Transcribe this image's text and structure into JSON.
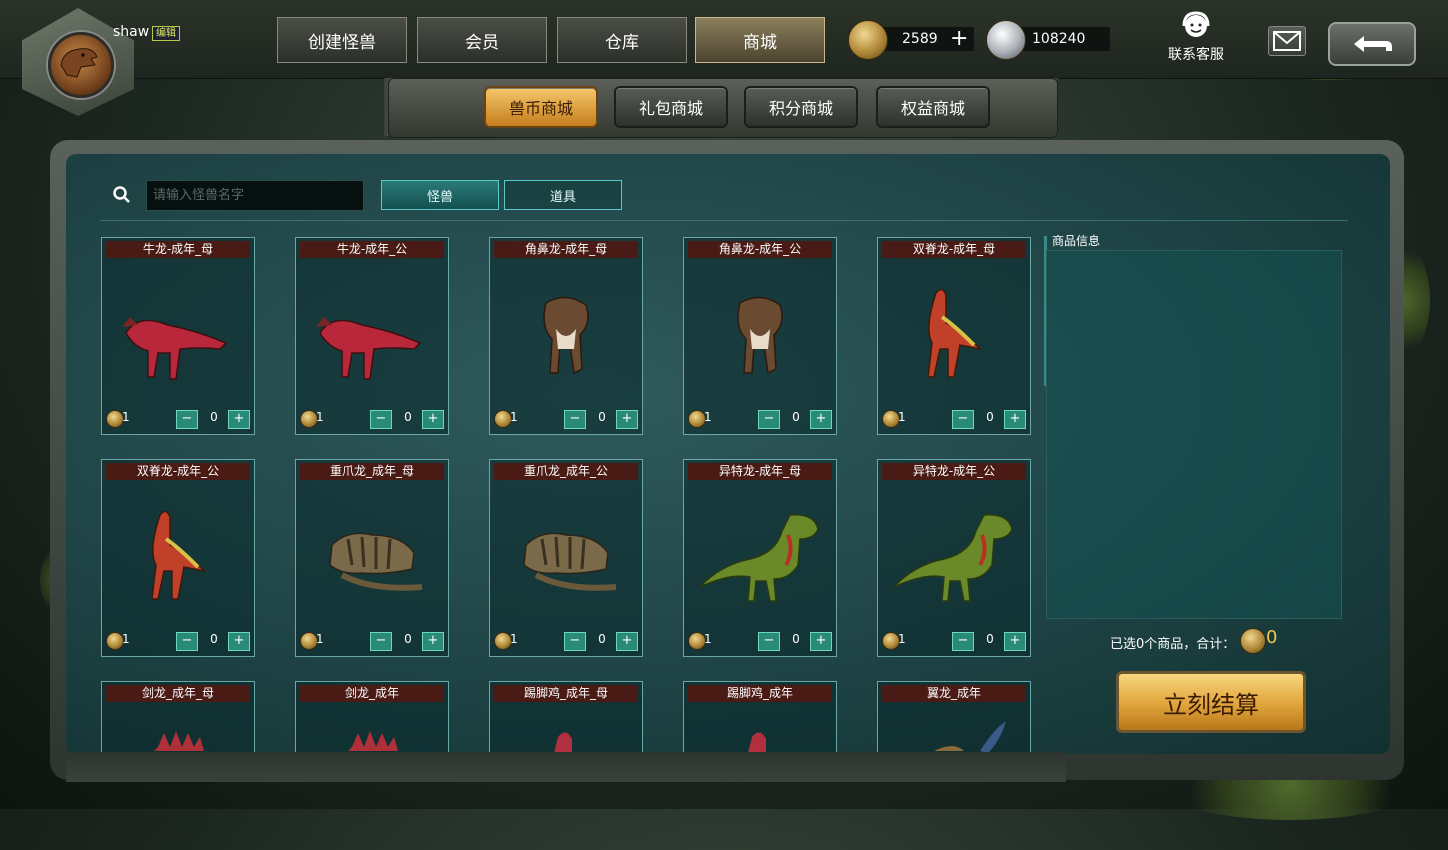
{
  "user": {
    "name": "shaw",
    "edit_label": "编辑"
  },
  "nav": [
    {
      "label": "创建怪兽",
      "active": false
    },
    {
      "label": "会员",
      "active": false
    },
    {
      "label": "仓库",
      "active": false
    },
    {
      "label": "商城",
      "active": true
    }
  ],
  "currency": {
    "gold": "2589",
    "silver": "108240"
  },
  "service_label": "联系客服",
  "shop_tabs": [
    {
      "label": "兽币商城",
      "active": true
    },
    {
      "label": "礼包商城",
      "active": false
    },
    {
      "label": "积分商城",
      "active": false
    },
    {
      "label": "权益商城",
      "active": false
    }
  ],
  "search": {
    "placeholder": "请输入怪兽名字"
  },
  "filter_tabs": [
    {
      "label": "怪兽",
      "active": true
    },
    {
      "label": "道具",
      "active": false
    }
  ],
  "products": [
    {
      "name": "牛龙-成年_母",
      "price": "1",
      "qty": "0",
      "icon": "carnotaurus"
    },
    {
      "name": "牛龙-成年_公",
      "price": "1",
      "qty": "0",
      "icon": "carnotaurus"
    },
    {
      "name": "角鼻龙-成年_母",
      "price": "1",
      "qty": "0",
      "icon": "ceratosaurus"
    },
    {
      "name": "角鼻龙-成年_公",
      "price": "1",
      "qty": "0",
      "icon": "ceratosaurus"
    },
    {
      "name": "双脊龙-成年_母",
      "price": "1",
      "qty": "0",
      "icon": "dilophosaurus"
    },
    {
      "name": "双脊龙-成年_公",
      "price": "1",
      "qty": "0",
      "icon": "dilophosaurus"
    },
    {
      "name": "重爪龙_成年_母",
      "price": "1",
      "qty": "0",
      "icon": "baryonyx"
    },
    {
      "name": "重爪龙_成年_公",
      "price": "1",
      "qty": "0",
      "icon": "baryonyx"
    },
    {
      "name": "异特龙-成年_母",
      "price": "1",
      "qty": "0",
      "icon": "allosaurus"
    },
    {
      "name": "异特龙-成年_公",
      "price": "1",
      "qty": "0",
      "icon": "allosaurus"
    },
    {
      "name": "剑龙_成年_母",
      "price": "",
      "qty": "",
      "icon": "stegosaurus"
    },
    {
      "name": "剑龙_成年",
      "price": "",
      "qty": "",
      "icon": "stegosaurus"
    },
    {
      "name": "踢脚鸡_成年_母",
      "price": "",
      "qty": "",
      "icon": "bird"
    },
    {
      "name": "踢脚鸡_成年",
      "price": "",
      "qty": "",
      "icon": "bird"
    },
    {
      "name": "翼龙_成年",
      "price": "",
      "qty": "",
      "icon": "pterosaur"
    }
  ],
  "info": {
    "label": "商品信息",
    "summary": "已选0个商品，合计：",
    "total": "0",
    "checkout": "立刻结算"
  },
  "colors": {
    "accent_gold": "#f2c64a",
    "panel_teal": "#1f4446",
    "card_title_bg": "#4a1a14",
    "step_button": "#2a8a78"
  }
}
